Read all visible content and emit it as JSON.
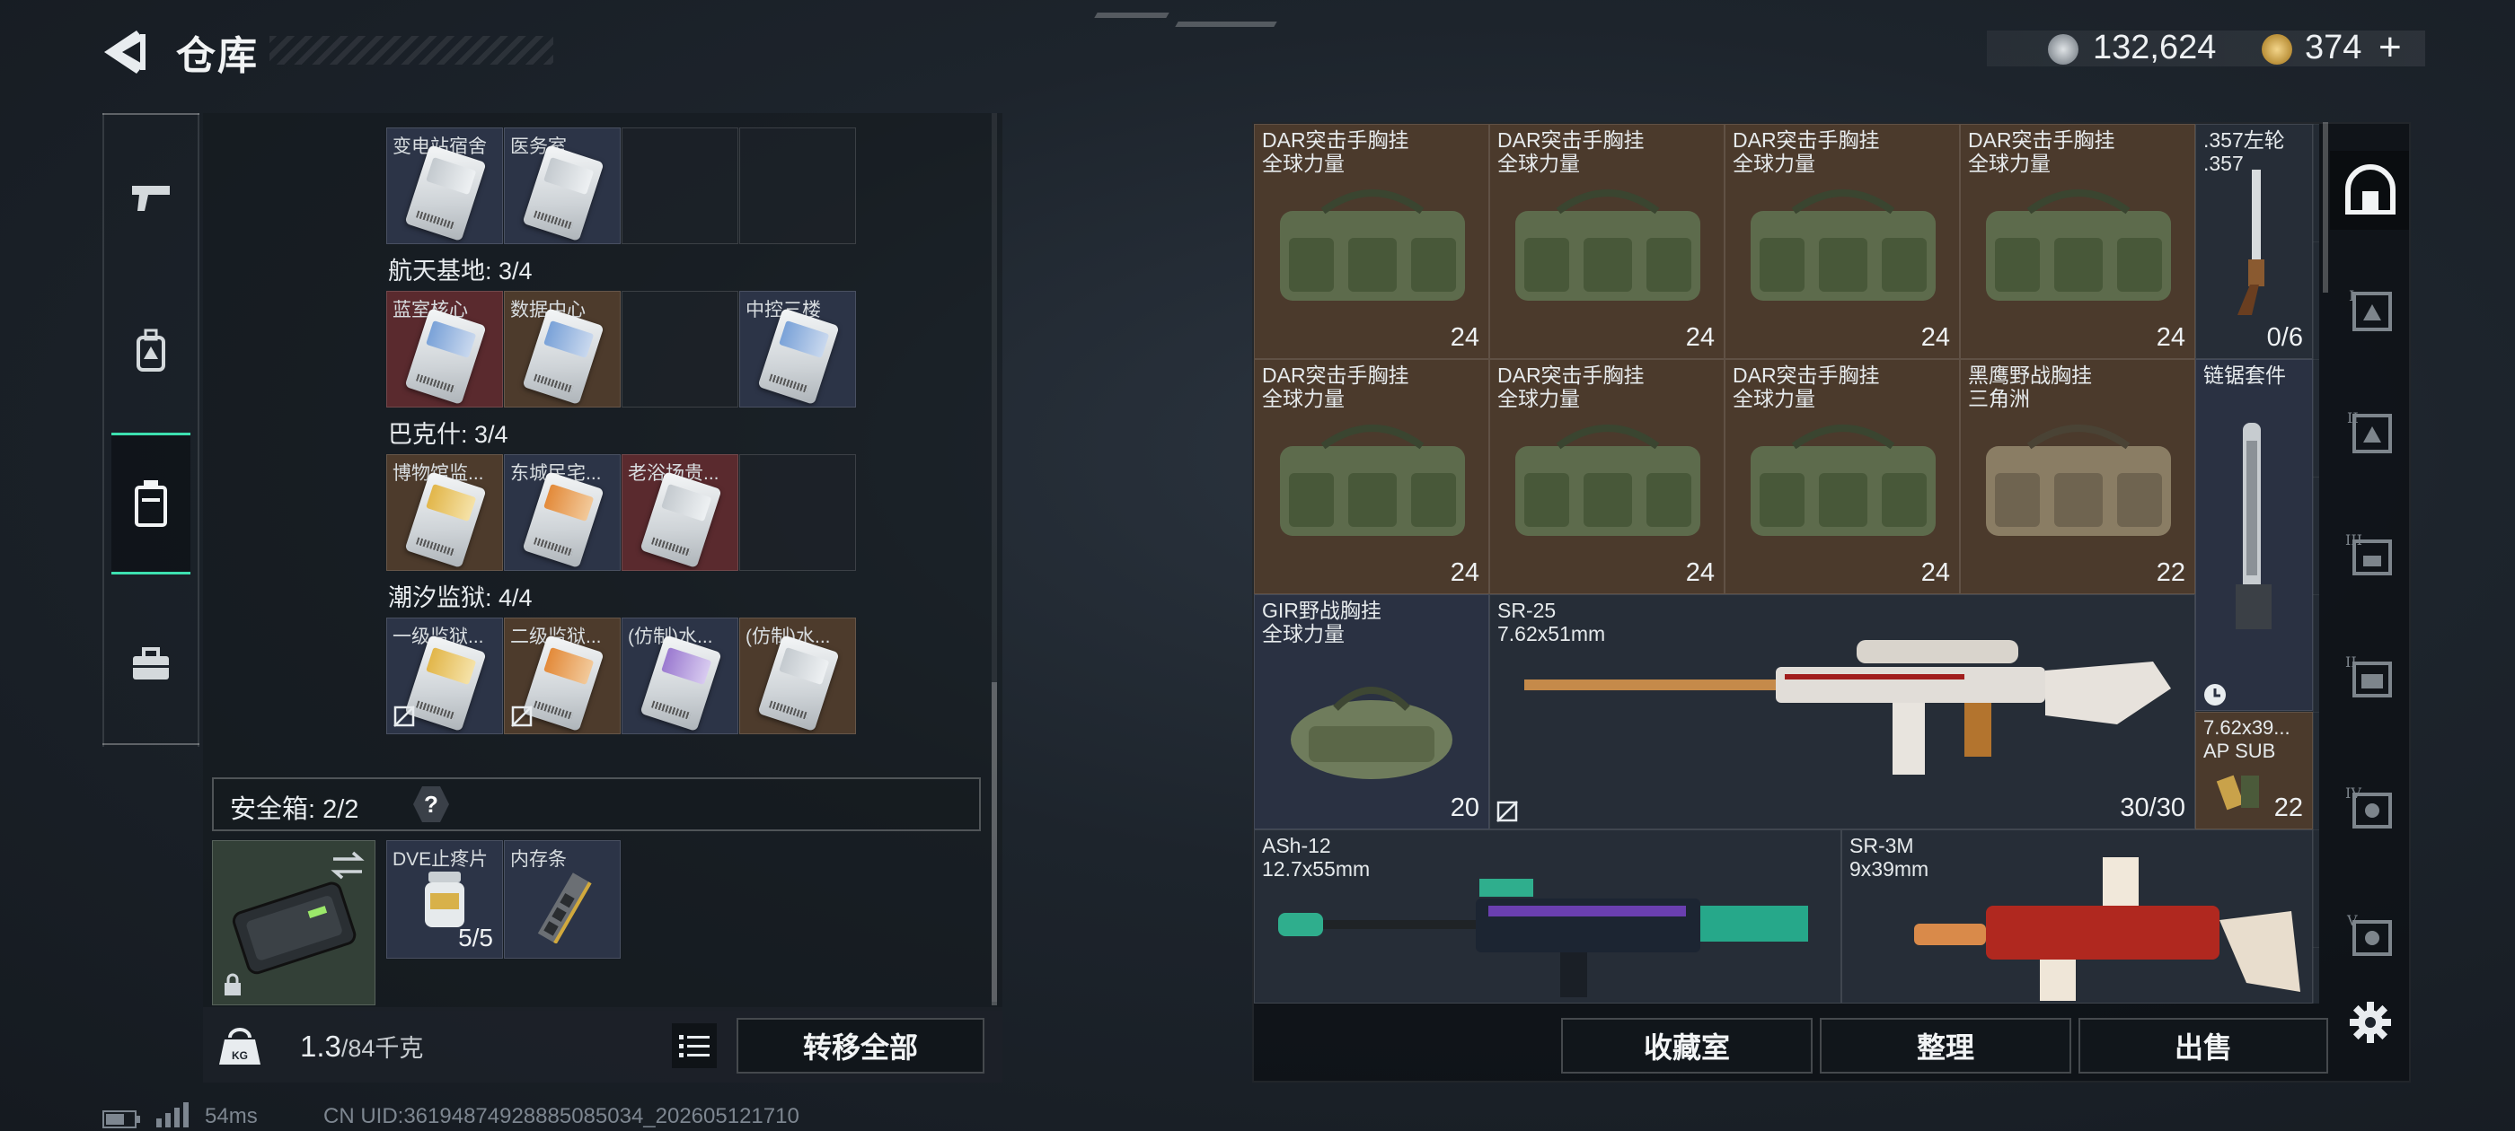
{
  "header": {
    "title": "仓库",
    "currency_primary": "132,624",
    "currency_secondary": "374",
    "add_symbol": "+"
  },
  "left_nav": [
    "weapons",
    "equipment",
    "containers",
    "items"
  ],
  "sections": [
    {
      "label": "",
      "slots": [
        "变电站宿舍",
        "医务室",
        "",
        ""
      ]
    },
    {
      "label": "航天基地: 3/4",
      "slots": [
        "蓝室核心",
        "数据中心",
        "",
        "中控三楼"
      ]
    },
    {
      "label": "巴克什: 3/4",
      "slots": [
        "博物馆监...",
        "东城民宅...",
        "老浴场贵...",
        ""
      ]
    },
    {
      "label": "潮汐监狱: 4/4",
      "slots": [
        "一级监狱...",
        "二级监狱...",
        "(仿制)水...",
        "(仿制)水..."
      ]
    }
  ],
  "safebox": {
    "label": "安全箱: 2/2",
    "help": "?",
    "items": [
      {
        "name": "DVE止疼片",
        "count": "5/5"
      },
      {
        "name": "内存条",
        "count": ""
      }
    ]
  },
  "weight": {
    "current": "1.3",
    "max": "/84千克"
  },
  "buttons": {
    "transfer_all": "转移全部",
    "collection": "收藏室",
    "organize": "整理",
    "sell": "出售"
  },
  "stash": {
    "row1": [
      {
        "name1": "DAR突击手胸挂",
        "name2": "全球力量",
        "count": "24"
      },
      {
        "name1": "DAR突击手胸挂",
        "name2": "全球力量",
        "count": "24"
      },
      {
        "name1": "DAR突击手胸挂",
        "name2": "全球力量",
        "count": "24"
      },
      {
        "name1": "DAR突击手胸挂",
        "name2": "全球力量",
        "count": "24"
      }
    ],
    "row2": [
      {
        "name1": "DAR突击手胸挂",
        "name2": "全球力量",
        "count": "24"
      },
      {
        "name1": "DAR突击手胸挂",
        "name2": "全球力量",
        "count": "24"
      },
      {
        "name1": "DAR突击手胸挂",
        "name2": "全球力量",
        "count": "24"
      },
      {
        "name1": "黑鹰野战胸挂",
        "name2": "三角洲",
        "count": "22"
      }
    ],
    "revolver": {
      "name1": ".357左轮",
      "name2": ".357",
      "count": "0/6"
    },
    "chainsaw": {
      "name1": "链锯套件"
    },
    "gir": {
      "name1": "GIR野战胸挂",
      "name2": "全球力量",
      "count": "20"
    },
    "sr25": {
      "name1": "SR-25",
      "name2": "7.62x51mm",
      "count": "30/30"
    },
    "ammo": {
      "name1": "7.62x39...",
      "name2": "AP SUB",
      "count": "22"
    },
    "ash12": {
      "name1": "ASh-12",
      "name2": "12.7x55mm"
    },
    "sr3m": {
      "name1": "SR-3M",
      "name2": "9x39mm"
    }
  },
  "right_nav": [
    "I",
    "II",
    "III",
    "IV",
    "V"
  ],
  "footer": {
    "ping": "54ms",
    "uid": "CN UID:3619487492888508503​4_202605121710"
  },
  "colors": {
    "accent": "#3de0b0",
    "brown_slot": "#4b3a2c",
    "blue_slot": "#2a3142",
    "red_slot": "#5a2a2e"
  }
}
